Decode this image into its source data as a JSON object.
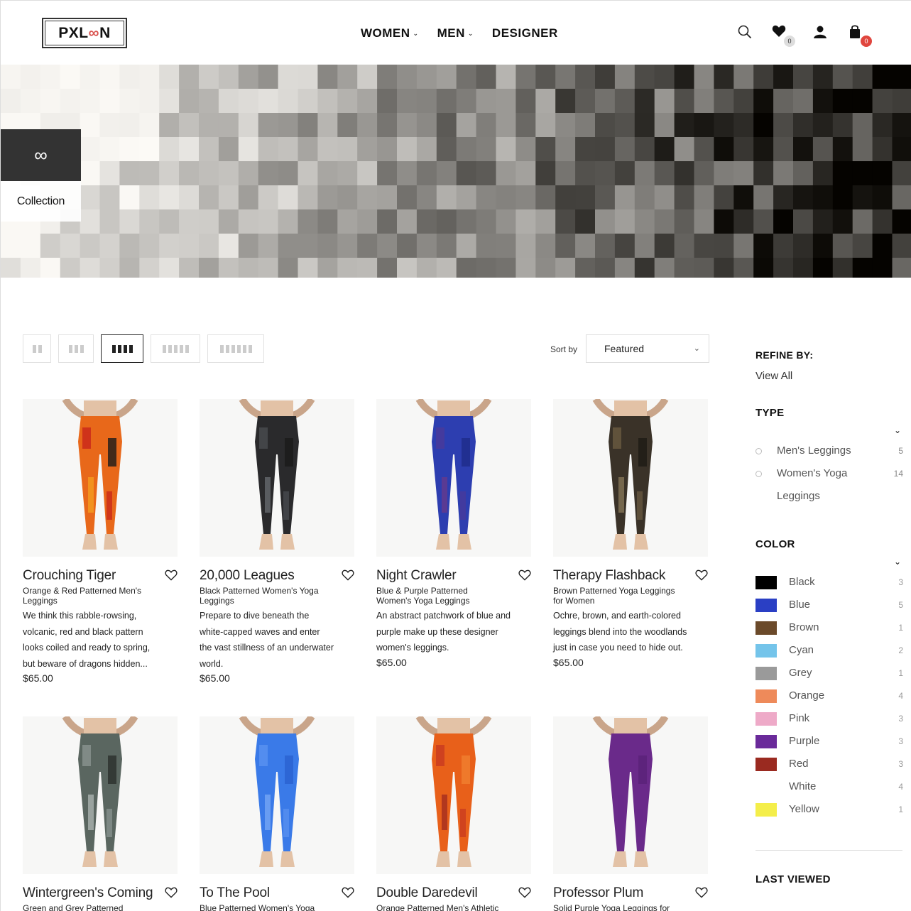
{
  "header": {
    "logo": {
      "left": "PX",
      "mid": "L",
      "oo": "∞",
      "right": "N"
    },
    "nav": [
      {
        "label": "WOMEN",
        "has_dropdown": true
      },
      {
        "label": "MEN",
        "has_dropdown": true
      },
      {
        "label": "DESIGNER",
        "has_dropdown": false
      }
    ],
    "wishlist_count": "0",
    "cart_count": "0"
  },
  "hero": {
    "collection_icon": "∞",
    "collection_label": "Collection"
  },
  "toolbar": {
    "layouts": [
      2,
      3,
      4,
      5,
      6
    ],
    "active_layout": 4,
    "sort_label": "Sort by",
    "sort_value": "Featured"
  },
  "products": [
    {
      "name": "Crouching Tiger",
      "subtitle": "Orange & Red Patterned Men's Leggings",
      "description": "We think this rabble-rowsing, volcanic, red and black pattern looks coiled and ready to spring, but beware of dragons hidden...",
      "price": "$65.00",
      "colors": [
        "#e8681a",
        "#c8261a",
        "#1a1a1a",
        "#f5a020"
      ]
    },
    {
      "name": "20,000 Leagues",
      "subtitle": "Black Patterned Women's Yoga Leggings",
      "description": "Prepare to dive beneath the white-capped waves and enter the vast stillness of an underwater world.",
      "price": "$65.00",
      "colors": [
        "#2a2a2c",
        "#4a4c50",
        "#1a1a1a",
        "#6a6d72"
      ]
    },
    {
      "name": "Night Crawler",
      "subtitle": "Blue & Purple Patterned Women's Yoga Leggings",
      "description": "An abstract patchwork of blue and purple make up these designer women's leggings.",
      "price": "$65.00",
      "colors": [
        "#2d3eb0",
        "#4a3a9a",
        "#1e2c8a",
        "#6a3a8a"
      ]
    },
    {
      "name": "Therapy Flashback",
      "subtitle": "Brown Patterned Yoga Leggings for Women",
      "description": "Ochre, brown, and earth-colored leggings blend into the woodlands just in case you need to hide out.",
      "price": "$65.00",
      "colors": [
        "#3a3228",
        "#6a5a40",
        "#1e1a14",
        "#8a7a5a"
      ]
    },
    {
      "name": "Wintergreen's Coming",
      "subtitle": "Green and Grey Patterned",
      "description": "",
      "price": "",
      "colors": [
        "#5a6660",
        "#8a9490",
        "#2a302c",
        "#b0b8b4"
      ]
    },
    {
      "name": "To The Pool",
      "subtitle": "Blue Patterned Women's Yoga",
      "description": "",
      "price": "",
      "colors": [
        "#3a7ae8",
        "#5a92f0",
        "#2a62d0",
        "#7aaaf5"
      ]
    },
    {
      "name": "Double Daredevil",
      "subtitle": "Orange Patterned Men's Athletic",
      "description": "",
      "price": "",
      "colors": [
        "#e8601a",
        "#c83a20",
        "#f08030",
        "#a02a20"
      ]
    },
    {
      "name": "Professor Plum",
      "subtitle": "Solid Purple Yoga Leggings for",
      "description": "",
      "price": "",
      "colors": [
        "#6a2a8a",
        "#6a2a8a",
        "#5a2278",
        "#6a2a8a"
      ]
    }
  ],
  "sidebar": {
    "refine_by": "REFINE BY:",
    "view_all": "View All",
    "type_heading": "TYPE",
    "types": [
      {
        "label": "Men's Leggings",
        "count": "5"
      },
      {
        "label": "Women's Yoga Leggings",
        "label_line1": "Women's Yoga",
        "label_line2": "Leggings",
        "count": "14"
      }
    ],
    "color_heading": "COLOR",
    "colors": [
      {
        "label": "Black",
        "count": "3",
        "swatch": "#000000"
      },
      {
        "label": "Blue",
        "count": "5",
        "swatch": "#2a3fc4"
      },
      {
        "label": "Brown",
        "count": "1",
        "swatch": "#6b4a2a"
      },
      {
        "label": "Cyan",
        "count": "2",
        "swatch": "#74c4ea"
      },
      {
        "label": "Grey",
        "count": "1",
        "swatch": "#9a9a9a"
      },
      {
        "label": "Orange",
        "count": "4",
        "swatch": "#ee8a5a"
      },
      {
        "label": "Pink",
        "count": "3",
        "swatch": "#eeaac8"
      },
      {
        "label": "Purple",
        "count": "3",
        "swatch": "#6a2a9a"
      },
      {
        "label": "Red",
        "count": "3",
        "swatch": "#9a2a20"
      },
      {
        "label": "White",
        "count": "4",
        "swatch": "#ffffff"
      },
      {
        "label": "Yellow",
        "count": "1",
        "swatch": "#f4ee4a"
      }
    ],
    "last_viewed": "LAST VIEWED"
  }
}
